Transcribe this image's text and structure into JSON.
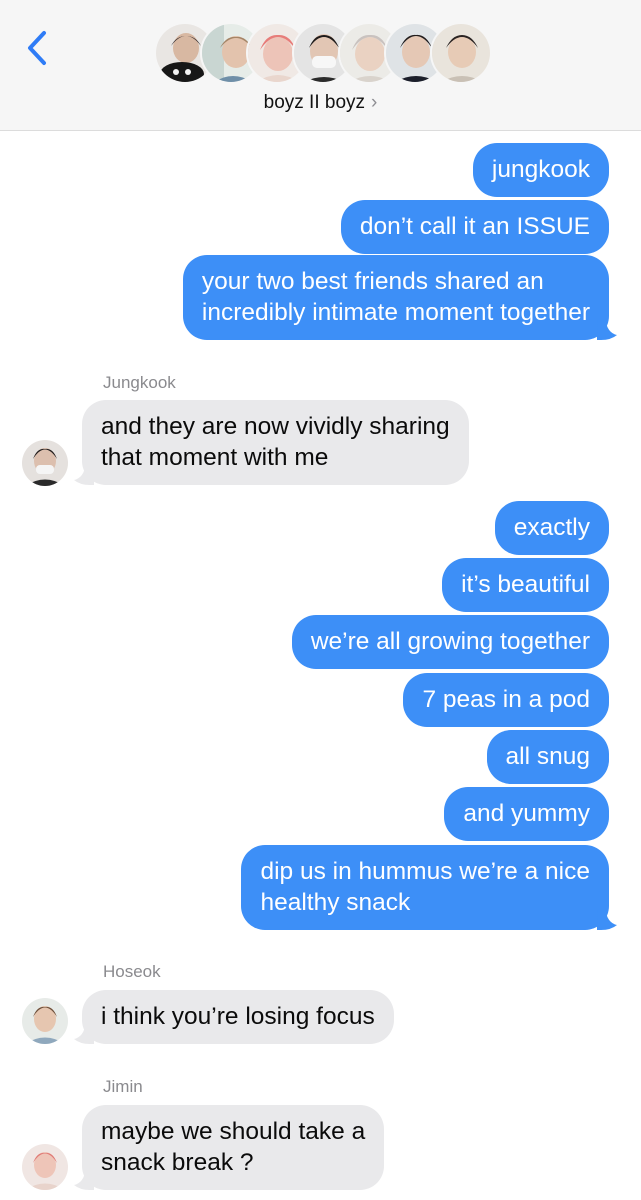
{
  "header": {
    "group_name": "boyz II boyz",
    "chevron": "›",
    "back_icon": "chevron-left-icon",
    "avatar_count": 7
  },
  "colors": {
    "outgoing_bubble": "#3d8ff7",
    "incoming_bubble": "#e9e9eb",
    "accent": "#2f7cf6"
  },
  "messages": [
    {
      "dir": "out",
      "lines": [
        "jungkook"
      ]
    },
    {
      "dir": "out",
      "lines": [
        "don’t call it an ISSUE"
      ]
    },
    {
      "dir": "out",
      "lines": [
        "your two best friends shared an",
        "incredibly intimate moment together"
      ]
    },
    {
      "dir": "in",
      "sender": "Jungkook",
      "lines": [
        "and they are now vividly sharing",
        "that moment with me"
      ]
    },
    {
      "dir": "out",
      "lines": [
        "exactly"
      ]
    },
    {
      "dir": "out",
      "lines": [
        "it’s beautiful"
      ]
    },
    {
      "dir": "out",
      "lines": [
        "we’re all growing together"
      ]
    },
    {
      "dir": "out",
      "lines": [
        "7 peas in a pod"
      ]
    },
    {
      "dir": "out",
      "lines": [
        "all snug"
      ]
    },
    {
      "dir": "out",
      "lines": [
        "and yummy"
      ]
    },
    {
      "dir": "out",
      "lines": [
        "dip us in hummus we’re a nice",
        "healthy snack"
      ]
    },
    {
      "dir": "in",
      "sender": "Hoseok",
      "lines": [
        "i think you’re losing focus"
      ]
    },
    {
      "dir": "in",
      "sender": "Jimin",
      "lines": [
        "maybe we should take a",
        "snack break ?"
      ]
    }
  ]
}
